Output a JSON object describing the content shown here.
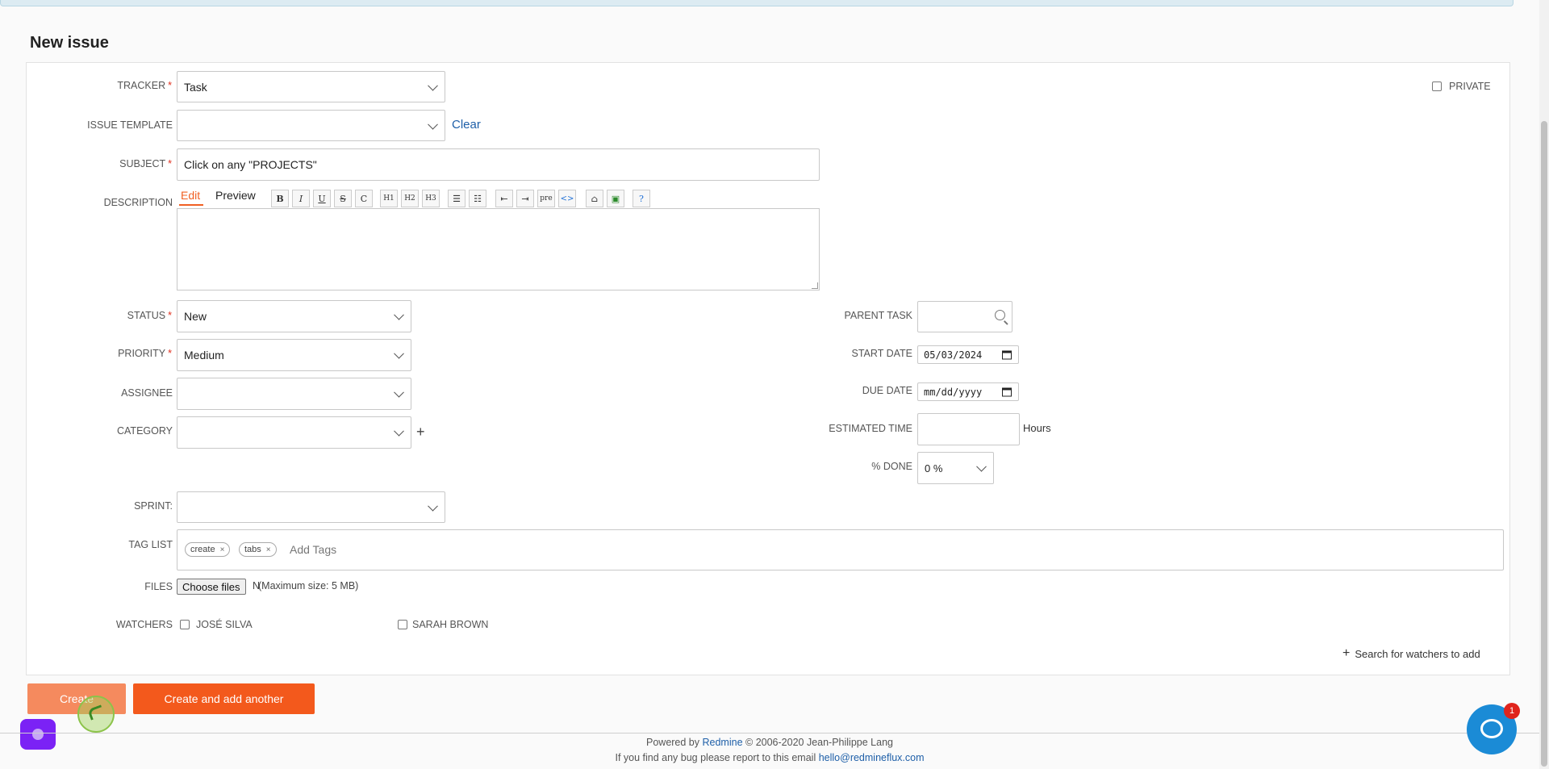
{
  "page": {
    "title": "New issue"
  },
  "tracker": {
    "label": "TRACKER",
    "value": "Task"
  },
  "private": {
    "label": "PRIVATE"
  },
  "issue_template": {
    "label": "ISSUE TEMPLATE",
    "value": "",
    "clear_label": "Clear"
  },
  "subject": {
    "label": "SUBJECT",
    "value": "Click on any \"PROJECTS\""
  },
  "description": {
    "label": "DESCRIPTION",
    "tabs": [
      "Edit",
      "Preview"
    ],
    "toolbar": [
      "B",
      "I",
      "U",
      "S",
      "C",
      "H1",
      "H2",
      "H3",
      "ul",
      "ol",
      "indent-left",
      "indent-right",
      "pre",
      "<>",
      "image-link",
      "image",
      "help"
    ]
  },
  "status": {
    "label": "STATUS",
    "value": "New"
  },
  "priority": {
    "label": "PRIORITY",
    "value": "Medium"
  },
  "assignee": {
    "label": "ASSIGNEE",
    "value": ""
  },
  "category": {
    "label": "CATEGORY",
    "value": ""
  },
  "parent_task": {
    "label": "PARENT TASK",
    "value": ""
  },
  "start_date": {
    "label": "START DATE",
    "value": "05/03/2024"
  },
  "due_date": {
    "label": "DUE DATE",
    "value": "mm/dd/yyyy"
  },
  "estimated_time": {
    "label": "ESTIMATED TIME",
    "value": "",
    "unit": "Hours"
  },
  "done": {
    "label": "% DONE",
    "value": "0 %"
  },
  "sprint": {
    "label": "SPRINT:",
    "value": ""
  },
  "tags": {
    "label": "TAG LIST",
    "items": [
      "create",
      "tabs"
    ],
    "placeholder": "Add Tags"
  },
  "files": {
    "label": "FILES",
    "button": "Choose files",
    "truncated": "N",
    "max_size": "(Maximum size: 5 MB)"
  },
  "watchers": {
    "label": "WATCHERS",
    "people": [
      "JOSÉ SILVA",
      "SARAH BROWN"
    ],
    "search_label": "Search for watchers to add"
  },
  "actions": {
    "create": "Create",
    "create_another": "Create and add another"
  },
  "footer": {
    "powered_prefix": "Powered by",
    "powered_link": "Redmine",
    "powered_suffix": "© 2006-2020 Jean-Philippe Lang",
    "bug_text": "If you find any bug please report to this email",
    "bug_email": "hello@redmineflux.com"
  },
  "chat": {
    "badge_count": "1"
  },
  "colors": {
    "accent": "#f3591c",
    "link": "#1e5fa8",
    "chat": "#1b8bd6",
    "widget": "#7b22f5"
  }
}
